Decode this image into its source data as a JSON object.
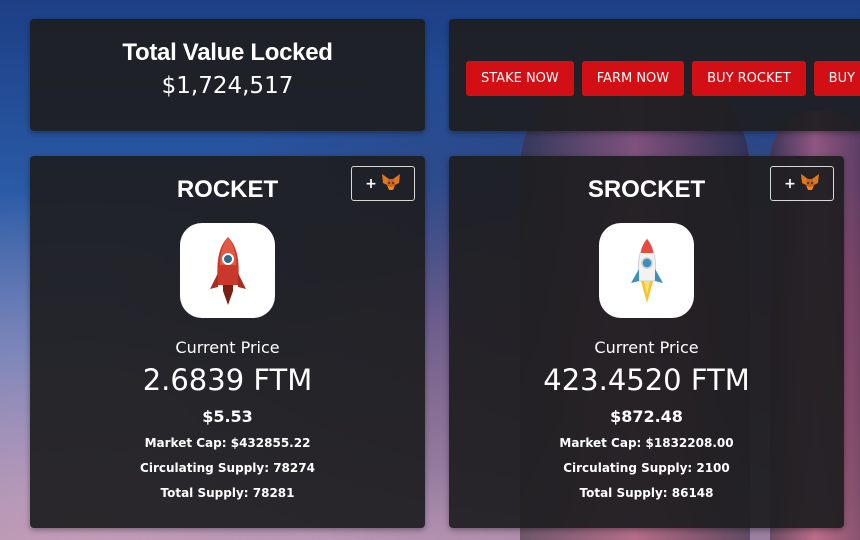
{
  "tvl": {
    "title": "Total Value Locked",
    "value": "$1,724,517"
  },
  "actions": {
    "buttons": [
      "STAKE NOW",
      "FARM NOW",
      "BUY ROCKET",
      "BUY"
    ]
  },
  "tokens": [
    {
      "name": "ROCKET",
      "add_label": "+",
      "price_label": "Current Price",
      "price": "2.6839 FTM",
      "usd": "$5.53",
      "market_cap": "Market Cap: $432855.22",
      "circulating_supply": "Circulating Supply: 78274",
      "total_supply": "Total Supply: 78281",
      "icon": "red-rocket-icon"
    },
    {
      "name": "SROCKET",
      "add_label": "+",
      "price_label": "Current Price",
      "price": "423.4520 FTM",
      "usd": "$872.48",
      "market_cap": "Market Cap: $1832208.00",
      "circulating_supply": "Circulating Supply: 2100",
      "total_supply": "Total Supply: 86148",
      "icon": "white-rocket-icon"
    }
  ],
  "colors": {
    "accent": "#d10f14",
    "panel": "#1e1e20"
  }
}
